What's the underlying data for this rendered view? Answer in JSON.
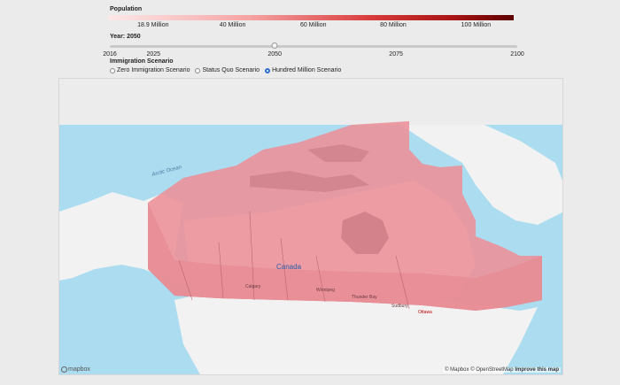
{
  "legend": {
    "title": "Population",
    "ticks": [
      {
        "label": "18.9 Million",
        "pos": 0.111
      },
      {
        "label": "40 Million",
        "pos": 0.307
      },
      {
        "label": "60 Million",
        "pos": 0.506
      },
      {
        "label": "80 Million",
        "pos": 0.703
      },
      {
        "label": "100 Million",
        "pos": 0.907
      }
    ]
  },
  "year": {
    "title": "Year: 2050",
    "value": 2050,
    "min": 2016,
    "max": 2100,
    "ticks": [
      "2016",
      "2025",
      "2050",
      "2075",
      "2100"
    ]
  },
  "scenario": {
    "title": "Immigration Scenario",
    "options": [
      {
        "label": "Zero Immigration Scenario",
        "checked": false
      },
      {
        "label": "Status Quo Scenario",
        "checked": false
      },
      {
        "label": "Hundred Million Scenario",
        "checked": true
      }
    ]
  },
  "map": {
    "country_label": "Canada",
    "ocean_label": "Arctic Ocean",
    "capital_label": "Ottawa",
    "city_labels": [
      "Calgary",
      "Winnipeg",
      "Thunder Bay",
      "Sudbury"
    ],
    "colors": {
      "water": "#abdcf0",
      "land": "#f2f2f2",
      "extrusion": "#ec8f97",
      "extrusion_dark": "#c97a84"
    },
    "logo_text": "mapbox",
    "attribution": {
      "mapbox": "© Mapbox",
      "osm": "© OpenStreetMap",
      "improve": "Improve this map"
    }
  }
}
